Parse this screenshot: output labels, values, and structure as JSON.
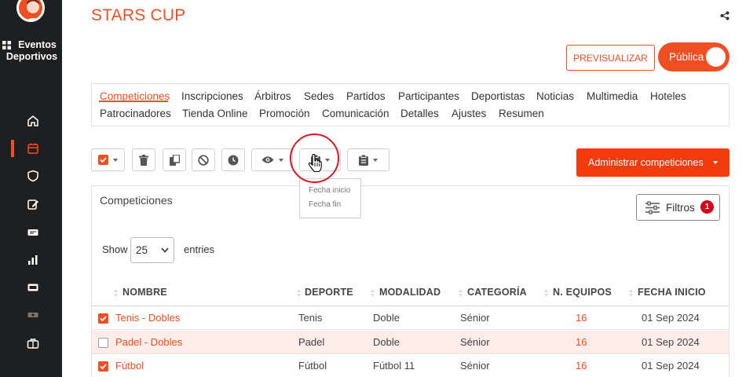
{
  "brand": {
    "line1": "Eventos",
    "line2": "Deportivos"
  },
  "header": {
    "title": "STARS CUP",
    "preview_label": "PREVISUALIZAR",
    "public_label": "Pública"
  },
  "tabs": [
    {
      "label": "Competiciones",
      "active": true
    },
    {
      "label": "Inscripciones"
    },
    {
      "label": "Árbitros"
    },
    {
      "label": "Sedes"
    },
    {
      "label": "Partidos"
    },
    {
      "label": "Participantes"
    },
    {
      "label": "Deportistas"
    },
    {
      "label": "Noticias"
    },
    {
      "label": "Multimedia"
    },
    {
      "label": "Hoteles"
    },
    {
      "label": "Patrocinadores"
    },
    {
      "label": "Tienda Online"
    },
    {
      "label": "Promoción"
    },
    {
      "label": "Comunicación"
    },
    {
      "label": "Detalles"
    },
    {
      "label": "Ajustes"
    },
    {
      "label": "Resumen"
    }
  ],
  "toolbar": {
    "admin_label": "Administrar competiciones",
    "dropdown_items": [
      "Fecha inicio",
      "Fecha fin"
    ]
  },
  "panel": {
    "title": "Competiciones",
    "filters_label": "Filtros",
    "filters_count": "1",
    "show_label": "Show",
    "entries_value": "25",
    "entries_label": "entries"
  },
  "table": {
    "columns": [
      "NOMBRE",
      "DEPORTE",
      "MODALIDAD",
      "CATEGORÍA",
      "N. EQUIPOS",
      "FECHA INICIO"
    ],
    "rows": [
      {
        "checked": true,
        "nombre": "Tenis - Dobles",
        "deporte": "Tenis",
        "modalidad": "Doble",
        "categoria": "Sénior",
        "equipos": "16",
        "fecha": "01 Sep 2024"
      },
      {
        "checked": false,
        "nombre": "Padel - Dobles",
        "deporte": "Padel",
        "modalidad": "Doble",
        "categoria": "Sénior",
        "equipos": "16",
        "fecha": "01 Sep 2024"
      },
      {
        "checked": true,
        "nombre": "Fútbol",
        "deporte": "Fútbol",
        "modalidad": "Fútbol 11",
        "categoria": "Sénior",
        "equipos": "16",
        "fecha": "01 Sep 2024"
      }
    ]
  },
  "colors": {
    "accent": "#f04e23",
    "sidebar": "#1e1f21",
    "highlight_row": "#fdece8",
    "badge": "#d7001c"
  }
}
